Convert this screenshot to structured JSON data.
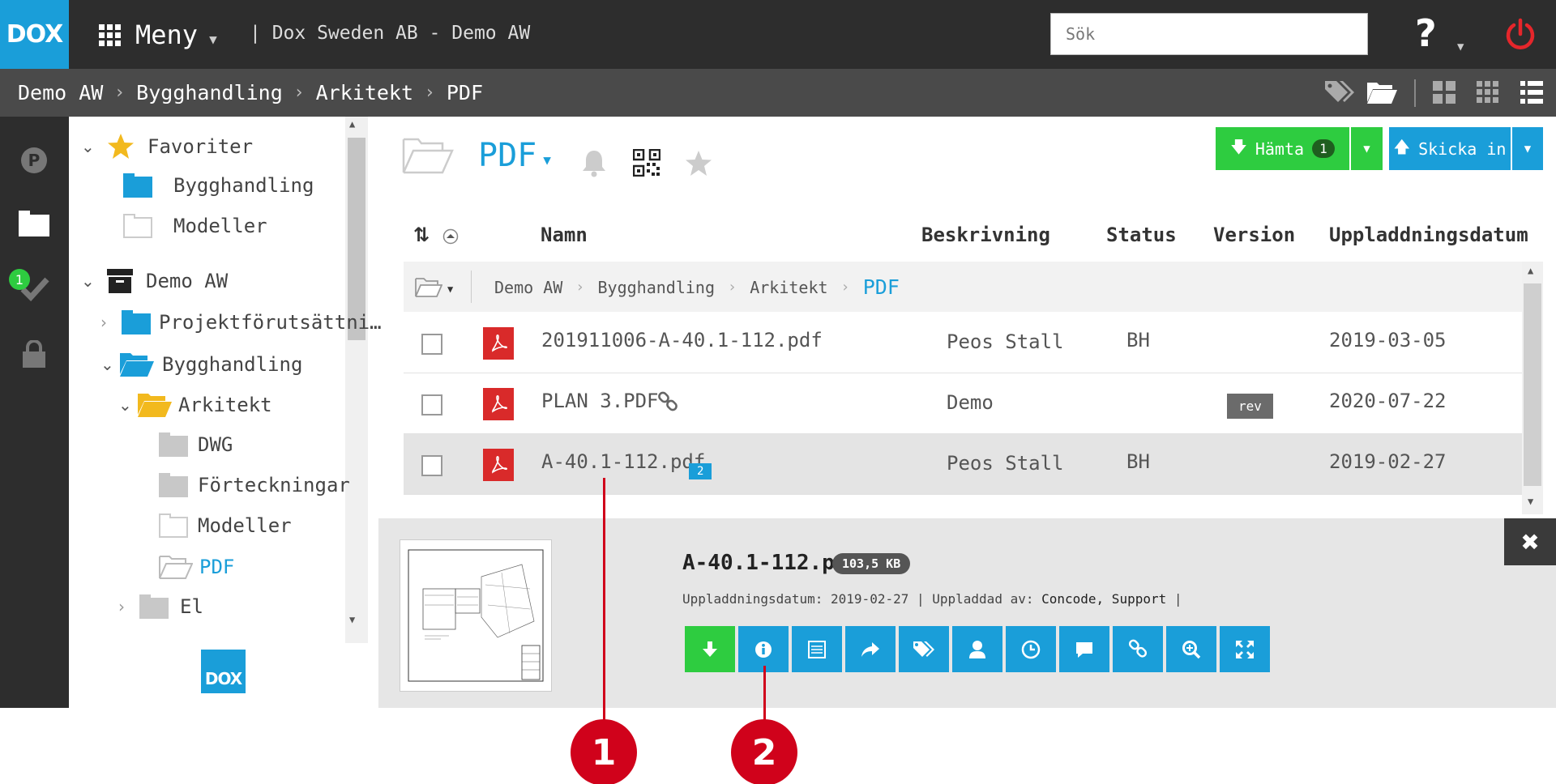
{
  "header": {
    "logo": "DOX",
    "menu_label": "Meny",
    "company": "| Dox Sweden AB - Demo AW",
    "search_placeholder": "Sök",
    "help_label": "?"
  },
  "breadcrumb": [
    "Demo AW",
    "Bygghandling",
    "Arkitekt",
    "PDF"
  ],
  "sidebar_rail": [
    {
      "icon": "parking-icon"
    },
    {
      "icon": "folder-icon"
    },
    {
      "icon": "check-icon",
      "badge": "1"
    },
    {
      "icon": "lock-icon"
    }
  ],
  "tree": {
    "items": [
      {
        "label": "Favoriter",
        "icon": "star-icon"
      },
      {
        "label": "Bygghandling",
        "icon": "folder-icon"
      },
      {
        "label": "Modeller",
        "icon": "folder-outline-icon"
      },
      {
        "label": "Demo AW",
        "icon": "archive-icon"
      },
      {
        "label": "Projektförutsättni…",
        "icon": "folder-icon"
      },
      {
        "label": "Bygghandling",
        "icon": "folder-open-icon"
      },
      {
        "label": "Arkitekt",
        "icon": "folder-open-icon"
      },
      {
        "label": "DWG",
        "icon": "folder-icon"
      },
      {
        "label": "Förteckningar",
        "icon": "folder-icon"
      },
      {
        "label": "Modeller",
        "icon": "folder-outline-icon"
      },
      {
        "label": "PDF",
        "icon": "folder-open-outline-icon"
      },
      {
        "label": "El",
        "icon": "folder-icon"
      }
    ],
    "footer_logo": "DOX"
  },
  "main": {
    "title": "PDF",
    "download_label": "Hämta",
    "download_count": "1",
    "upload_label": "Skicka in"
  },
  "table": {
    "headers": {
      "name": "Namn",
      "description": "Beskrivning",
      "status": "Status",
      "version": "Version",
      "date": "Uppladdningsdatum"
    },
    "path": [
      "Demo AW",
      "Bygghandling",
      "Arkitekt",
      "PDF"
    ],
    "rows": [
      {
        "name": "201911006-A-40.1-112.pdf",
        "description": "Peos Stall",
        "status": "BH",
        "version": "",
        "date": "2019-03-05"
      },
      {
        "name": "PLAN 3.PDF",
        "description": "Demo",
        "status": "",
        "version": "rev",
        "date": "2020-07-22"
      },
      {
        "name": "A-40.1-112.pdf",
        "description": "Peos Stall",
        "status": "BH",
        "version": "",
        "date": "2019-02-27",
        "comments": "2"
      }
    ]
  },
  "detail": {
    "file_name": "A-40.1-112.pdf",
    "file_size": "103,5 KB",
    "meta_prefix": "Uppladdningsdatum: 2019-02-27 | Uppladdad av: ",
    "meta_user": "Concode, Support",
    "meta_suffix": " |",
    "actions": [
      "download-icon",
      "info-icon",
      "list-icon",
      "share-icon",
      "tags-icon",
      "user-icon",
      "clock-icon",
      "comment-icon",
      "link-icon",
      "zoom-icon",
      "fullscreen-icon"
    ]
  },
  "callouts": [
    "1",
    "2"
  ],
  "colors": {
    "accent": "#1a9ed9",
    "green": "#2ecc40",
    "dark": "#2d2d2d",
    "callout": "#d0021b",
    "pdf": "#d92a2a"
  }
}
